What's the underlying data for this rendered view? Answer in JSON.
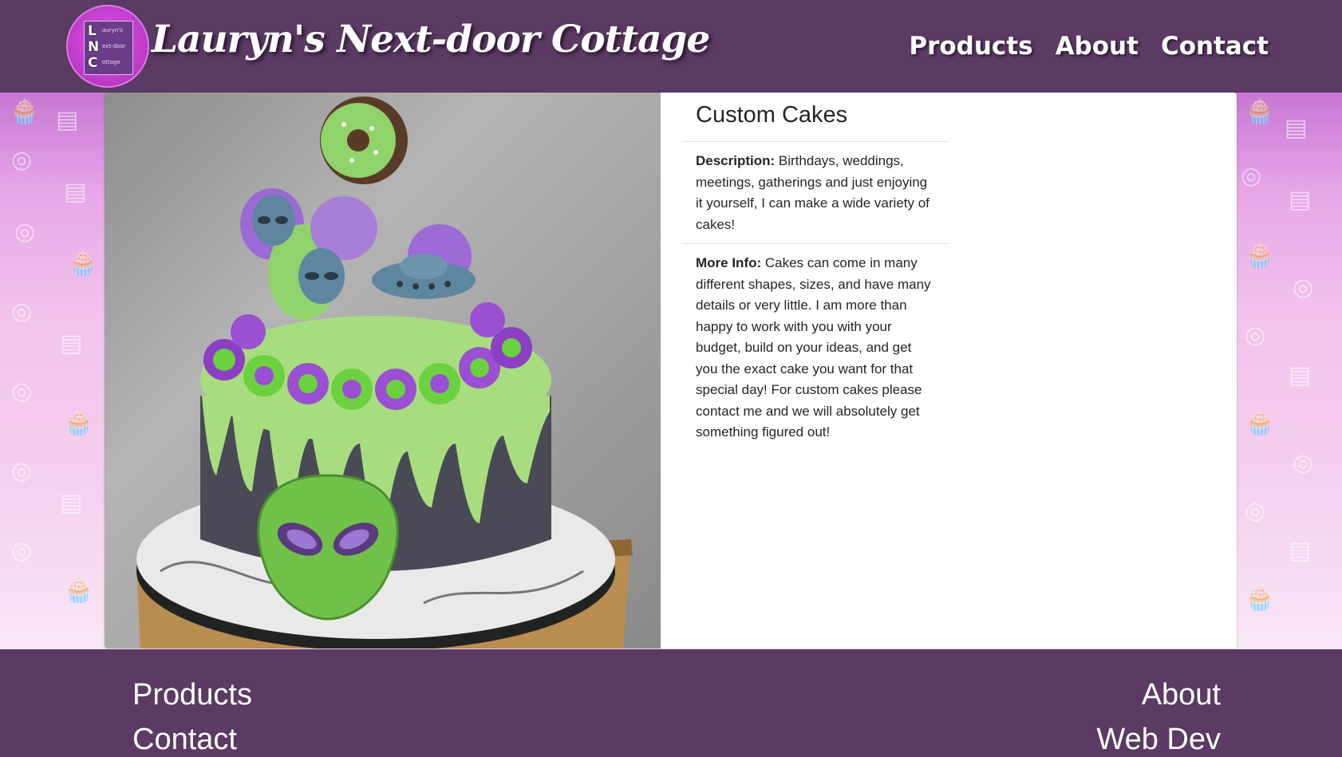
{
  "header": {
    "brand": "Lauryn's Next-door Cottage",
    "logo_letters": [
      "L",
      "N",
      "C"
    ],
    "logo_words": [
      "auryn's",
      "ext-door",
      "ottage"
    ],
    "nav": [
      "Products",
      "About",
      "Contact"
    ]
  },
  "product": {
    "title": "Custom Cakes",
    "description_label": "Description:",
    "description": "Birthdays, weddings, meetings, gatherings and just enjoying it yourself, I can make a wide variety of cakes!",
    "more_info_label": "More Info:",
    "more_info": "Cakes can come in many different shapes, sizes, and have many details or very little. I am more than happy to work with you with your budget, build on your ideas, and get you the exact cake you want for that special day! For custom cakes please contact me and we will absolutely get something figured out!"
  },
  "footer": {
    "products": "Products",
    "about": "About",
    "contact": "Contact",
    "webdev": "Web Dev"
  },
  "colors": {
    "header_bg": "#5b3a63",
    "accent": "#c43ed0",
    "frosting_green": "#8fd36a",
    "frosting_purple": "#9a4fd0"
  }
}
